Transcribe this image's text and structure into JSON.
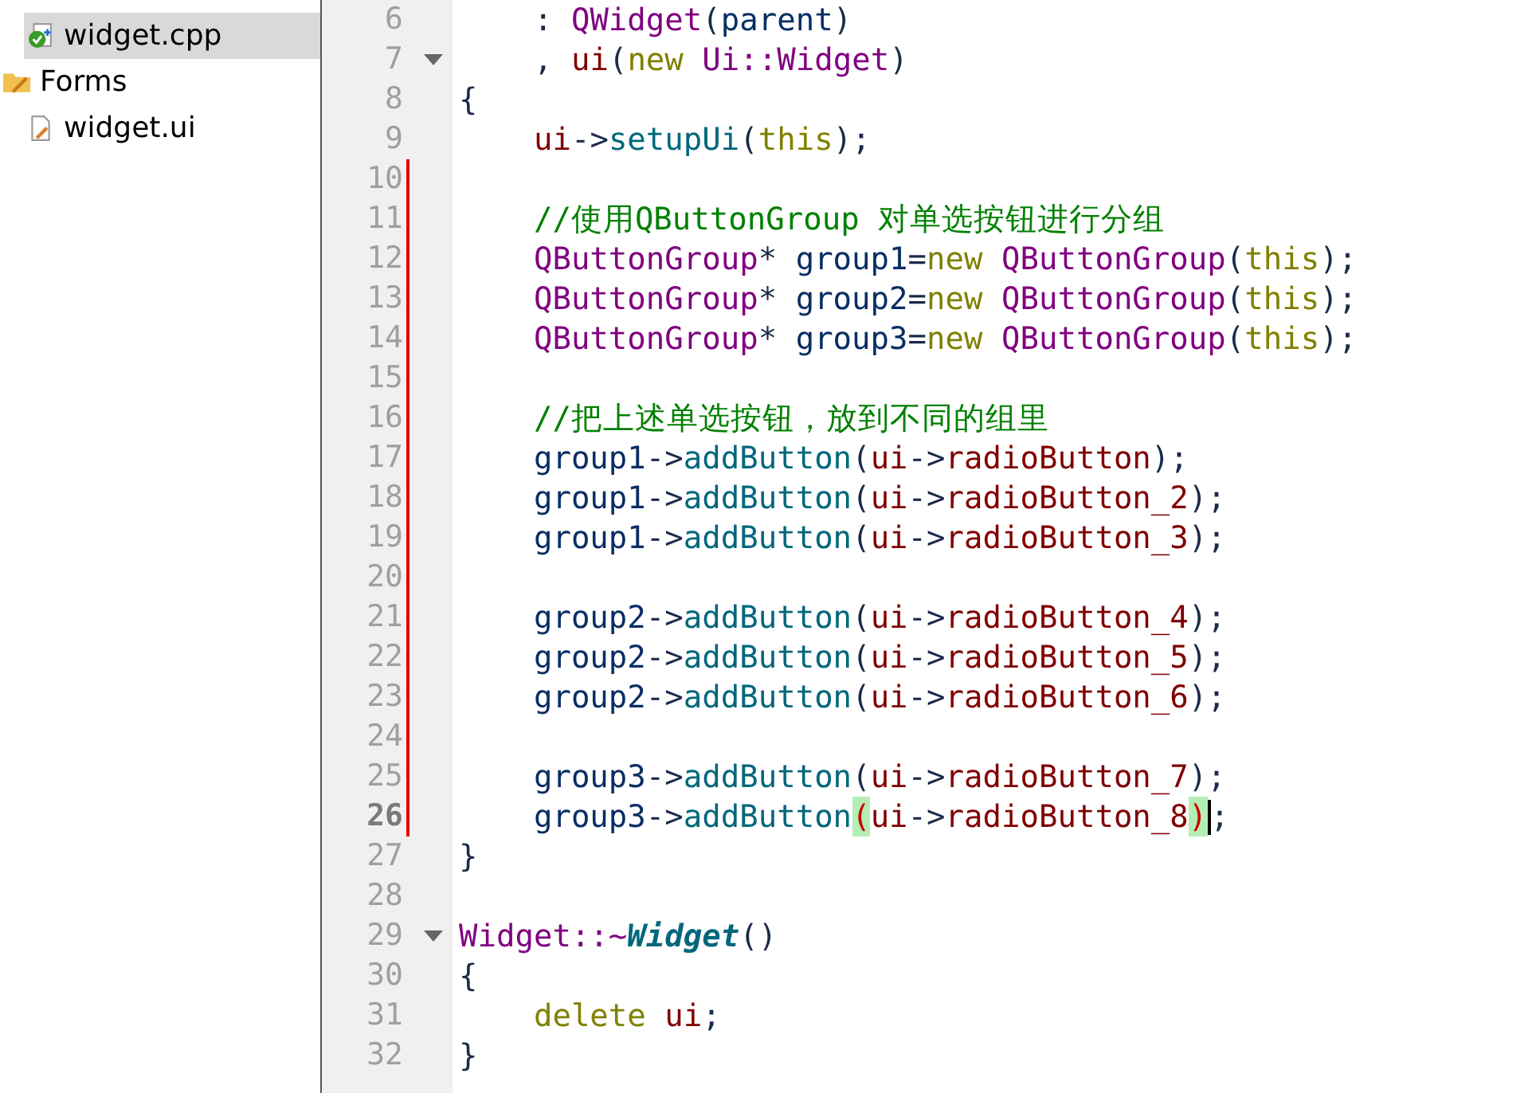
{
  "sidebar": {
    "items": [
      {
        "kind": "cpp-file",
        "label": "widget.cpp",
        "selected": true,
        "nested": true
      },
      {
        "kind": "folder",
        "label": "Forms",
        "selected": false,
        "nested": false,
        "children": [
          {
            "kind": "ui-file",
            "label": "widget.ui",
            "selected": false,
            "nested": true
          }
        ]
      }
    ]
  },
  "editor": {
    "lines": [
      {
        "number": "6",
        "fold": false,
        "modified": false,
        "current": false,
        "tokens": [
          {
            "kind": "plain",
            "text": "    : "
          },
          {
            "kind": "type",
            "text": "QWidget"
          },
          {
            "kind": "plain",
            "text": "("
          },
          {
            "kind": "var",
            "text": "parent"
          },
          {
            "kind": "plain",
            "text": ")"
          }
        ]
      },
      {
        "number": "7",
        "fold": true,
        "modified": false,
        "current": false,
        "tokens": [
          {
            "kind": "plain",
            "text": "    , "
          },
          {
            "kind": "member",
            "text": "ui"
          },
          {
            "kind": "plain",
            "text": "("
          },
          {
            "kind": "kw",
            "text": "new "
          },
          {
            "kind": "type",
            "text": "Ui::Widget"
          },
          {
            "kind": "plain",
            "text": ")"
          }
        ]
      },
      {
        "number": "8",
        "fold": false,
        "modified": false,
        "current": false,
        "tokens": [
          {
            "kind": "plain",
            "text": "{"
          }
        ]
      },
      {
        "number": "9",
        "fold": false,
        "modified": false,
        "current": false,
        "tokens": [
          {
            "kind": "member",
            "text": "    ui"
          },
          {
            "kind": "plain",
            "text": "->"
          },
          {
            "kind": "fn",
            "text": "setupUi"
          },
          {
            "kind": "plain",
            "text": "("
          },
          {
            "kind": "kw",
            "text": "this"
          },
          {
            "kind": "plain",
            "text": ");"
          }
        ]
      },
      {
        "number": "10",
        "fold": false,
        "modified": true,
        "current": false
      },
      {
        "number": "11",
        "fold": false,
        "modified": true,
        "current": false,
        "tokens": [
          {
            "kind": "comment",
            "text": "    //使用QButtonGroup 对单选按钮进行分组"
          }
        ]
      },
      {
        "number": "12",
        "fold": false,
        "modified": true,
        "current": false,
        "tokens": [
          {
            "kind": "type",
            "text": "    QButtonGroup"
          },
          {
            "kind": "plain",
            "text": "* "
          },
          {
            "kind": "var",
            "text": "group1"
          },
          {
            "kind": "plain",
            "text": "="
          },
          {
            "kind": "kw",
            "text": "new "
          },
          {
            "kind": "type",
            "text": "QButtonGroup"
          },
          {
            "kind": "plain",
            "text": "("
          },
          {
            "kind": "kw",
            "text": "this"
          },
          {
            "kind": "plain",
            "text": ");"
          }
        ]
      },
      {
        "number": "13",
        "fold": false,
        "modified": true,
        "current": false,
        "tokens": [
          {
            "kind": "type",
            "text": "    QButtonGroup"
          },
          {
            "kind": "plain",
            "text": "* "
          },
          {
            "kind": "var",
            "text": "group2"
          },
          {
            "kind": "plain",
            "text": "="
          },
          {
            "kind": "kw",
            "text": "new "
          },
          {
            "kind": "type",
            "text": "QButtonGroup"
          },
          {
            "kind": "plain",
            "text": "("
          },
          {
            "kind": "kw",
            "text": "this"
          },
          {
            "kind": "plain",
            "text": ");"
          }
        ]
      },
      {
        "number": "14",
        "fold": false,
        "modified": true,
        "current": false,
        "tokens": [
          {
            "kind": "type",
            "text": "    QButtonGroup"
          },
          {
            "kind": "plain",
            "text": "* "
          },
          {
            "kind": "var",
            "text": "group3"
          },
          {
            "kind": "plain",
            "text": "="
          },
          {
            "kind": "kw",
            "text": "new "
          },
          {
            "kind": "type",
            "text": "QButtonGroup"
          },
          {
            "kind": "plain",
            "text": "("
          },
          {
            "kind": "kw",
            "text": "this"
          },
          {
            "kind": "plain",
            "text": ");"
          }
        ]
      },
      {
        "number": "15",
        "fold": false,
        "modified": true,
        "current": false
      },
      {
        "number": "16",
        "fold": false,
        "modified": true,
        "current": false,
        "tokens": [
          {
            "kind": "comment",
            "text": "    //把上述单选按钮，放到不同的组里"
          }
        ]
      },
      {
        "number": "17",
        "fold": false,
        "modified": true,
        "current": false,
        "tokens": [
          {
            "kind": "var",
            "text": "    group1"
          },
          {
            "kind": "plain",
            "text": "->"
          },
          {
            "kind": "fn",
            "text": "addButton"
          },
          {
            "kind": "plain",
            "text": "("
          },
          {
            "kind": "member",
            "text": "ui"
          },
          {
            "kind": "plain",
            "text": "->"
          },
          {
            "kind": "member",
            "text": "radioButton"
          },
          {
            "kind": "plain",
            "text": ");"
          }
        ]
      },
      {
        "number": "18",
        "fold": false,
        "modified": true,
        "current": false,
        "tokens": [
          {
            "kind": "var",
            "text": "    group1"
          },
          {
            "kind": "plain",
            "text": "->"
          },
          {
            "kind": "fn",
            "text": "addButton"
          },
          {
            "kind": "plain",
            "text": "("
          },
          {
            "kind": "member",
            "text": "ui"
          },
          {
            "kind": "plain",
            "text": "->"
          },
          {
            "kind": "member",
            "text": "radioButton_2"
          },
          {
            "kind": "plain",
            "text": ");"
          }
        ]
      },
      {
        "number": "19",
        "fold": false,
        "modified": true,
        "current": false,
        "tokens": [
          {
            "kind": "var",
            "text": "    group1"
          },
          {
            "kind": "plain",
            "text": "->"
          },
          {
            "kind": "fn",
            "text": "addButton"
          },
          {
            "kind": "plain",
            "text": "("
          },
          {
            "kind": "member",
            "text": "ui"
          },
          {
            "kind": "plain",
            "text": "->"
          },
          {
            "kind": "member",
            "text": "radioButton_3"
          },
          {
            "kind": "plain",
            "text": ");"
          }
        ]
      },
      {
        "number": "20",
        "fold": false,
        "modified": true,
        "current": false
      },
      {
        "number": "21",
        "fold": false,
        "modified": true,
        "current": false,
        "tokens": [
          {
            "kind": "var",
            "text": "    group2"
          },
          {
            "kind": "plain",
            "text": "->"
          },
          {
            "kind": "fn",
            "text": "addButton"
          },
          {
            "kind": "plain",
            "text": "("
          },
          {
            "kind": "member",
            "text": "ui"
          },
          {
            "kind": "plain",
            "text": "->"
          },
          {
            "kind": "member",
            "text": "radioButton_4"
          },
          {
            "kind": "plain",
            "text": ");"
          }
        ]
      },
      {
        "number": "22",
        "fold": false,
        "modified": true,
        "current": false,
        "tokens": [
          {
            "kind": "var",
            "text": "    group2"
          },
          {
            "kind": "plain",
            "text": "->"
          },
          {
            "kind": "fn",
            "text": "addButton"
          },
          {
            "kind": "plain",
            "text": "("
          },
          {
            "kind": "member",
            "text": "ui"
          },
          {
            "kind": "plain",
            "text": "->"
          },
          {
            "kind": "member",
            "text": "radioButton_5"
          },
          {
            "kind": "plain",
            "text": ");"
          }
        ]
      },
      {
        "number": "23",
        "fold": false,
        "modified": true,
        "current": false,
        "tokens": [
          {
            "kind": "var",
            "text": "    group2"
          },
          {
            "kind": "plain",
            "text": "->"
          },
          {
            "kind": "fn",
            "text": "addButton"
          },
          {
            "kind": "plain",
            "text": "("
          },
          {
            "kind": "member",
            "text": "ui"
          },
          {
            "kind": "plain",
            "text": "->"
          },
          {
            "kind": "member",
            "text": "radioButton_6"
          },
          {
            "kind": "plain",
            "text": ");"
          }
        ]
      },
      {
        "number": "24",
        "fold": false,
        "modified": true,
        "current": false
      },
      {
        "number": "25",
        "fold": false,
        "modified": true,
        "current": false,
        "tokens": [
          {
            "kind": "var",
            "text": "    group3"
          },
          {
            "kind": "plain",
            "text": "->"
          },
          {
            "kind": "fn",
            "text": "addButton"
          },
          {
            "kind": "plain",
            "text": "("
          },
          {
            "kind": "member",
            "text": "ui"
          },
          {
            "kind": "plain",
            "text": "->"
          },
          {
            "kind": "member",
            "text": "radioButton_7"
          },
          {
            "kind": "plain",
            "text": ");"
          }
        ]
      },
      {
        "number": "26",
        "fold": false,
        "modified": true,
        "current": true,
        "tokens": [
          {
            "kind": "var",
            "text": "    group3"
          },
          {
            "kind": "plain",
            "text": "->"
          },
          {
            "kind": "fn",
            "text": "addButton"
          },
          {
            "kind": "match",
            "text": "("
          },
          {
            "kind": "member",
            "text": "ui"
          },
          {
            "kind": "plain",
            "text": "->"
          },
          {
            "kind": "member",
            "text": "radioButton_8"
          },
          {
            "kind": "match",
            "text": ")"
          },
          {
            "kind": "plain",
            "text": ";"
          }
        ]
      },
      {
        "number": "27",
        "fold": false,
        "modified": false,
        "current": false,
        "tokens": [
          {
            "kind": "plain",
            "text": "}"
          }
        ]
      },
      {
        "number": "28",
        "fold": false,
        "modified": false,
        "current": false
      },
      {
        "number": "29",
        "fold": true,
        "modified": false,
        "current": false,
        "tokens": [
          {
            "kind": "type",
            "text": "Widget::~"
          },
          {
            "kind": "dtor",
            "text": "Widget"
          },
          {
            "kind": "plain",
            "text": "()"
          }
        ]
      },
      {
        "number": "30",
        "fold": false,
        "modified": false,
        "current": false,
        "tokens": [
          {
            "kind": "plain",
            "text": "{"
          }
        ]
      },
      {
        "number": "31",
        "fold": false,
        "modified": false,
        "current": false,
        "tokens": [
          {
            "kind": "kw",
            "text": "    delete "
          },
          {
            "kind": "member",
            "text": "ui"
          },
          {
            "kind": "plain",
            "text": ";"
          }
        ]
      },
      {
        "number": "32",
        "fold": false,
        "modified": false,
        "current": false,
        "tokens": [
          {
            "kind": "plain",
            "text": "}"
          }
        ]
      }
    ]
  }
}
